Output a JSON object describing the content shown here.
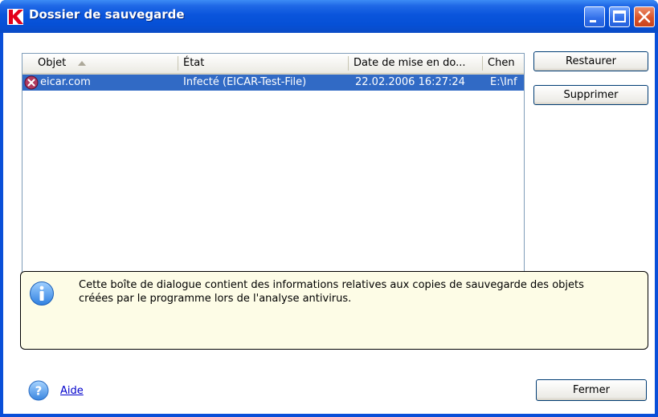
{
  "window": {
    "title": "Dossier de sauvegarde"
  },
  "listview": {
    "columns": [
      {
        "label": "Objet"
      },
      {
        "label": "État"
      },
      {
        "label": "Date de mise en do..."
      },
      {
        "label": "Chen"
      }
    ],
    "rows": [
      {
        "object": "eicar.com",
        "state": "Infecté (EICAR-Test-File)",
        "date": "22.02.2006 16:27:24",
        "path": "E:\\Inf",
        "selected": true
      }
    ]
  },
  "buttons": {
    "restore": "Restaurer",
    "delete": "Supprimer",
    "close": "Fermer"
  },
  "info": {
    "text_line1": "Cette boîte de dialogue contient des informations relatives aux copies de sauvegarde des objets",
    "text_line2": "créées par le programme lors de l'analyse antivirus."
  },
  "footer": {
    "help_label": "Aide"
  },
  "icons": {
    "app": "kaspersky-logo-icon",
    "row": "infected-object-icon",
    "info": "info-icon",
    "help": "help-icon"
  },
  "colors": {
    "titlebar": "#0a55dc",
    "selection": "#316ac5",
    "info_background": "#fdfce6",
    "close_button": "#d9552b"
  }
}
